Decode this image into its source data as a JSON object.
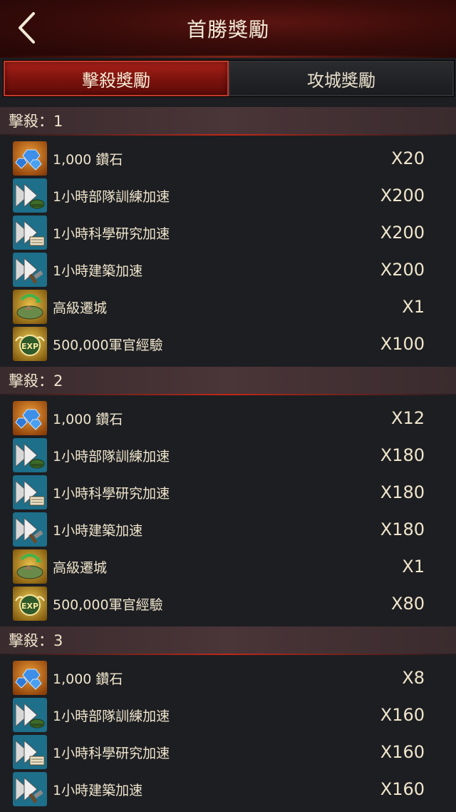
{
  "header": {
    "title": "首勝獎勵"
  },
  "tabs": [
    {
      "label": "擊殺獎勵",
      "active": true
    },
    {
      "label": "攻城獎勵",
      "active": false
    }
  ],
  "colors": {
    "accent": "#a82119",
    "icon_orange": "#c96a12",
    "icon_teal": "#1e6c86",
    "icon_gold": "#a87a18"
  },
  "sections": [
    {
      "label": "擊殺：1",
      "items": [
        {
          "icon": "diamond-icon",
          "name": "1,000 鑽石",
          "qty": "X20"
        },
        {
          "icon": "troop-speedup-icon",
          "name": "1小時部隊訓練加速",
          "qty": "X200"
        },
        {
          "icon": "research-speedup-icon",
          "name": "1小時科學研究加速",
          "qty": "X200"
        },
        {
          "icon": "build-speedup-icon",
          "name": "1小時建築加速",
          "qty": "X200"
        },
        {
          "icon": "relocate-icon",
          "name": "高級遷城",
          "qty": "X1"
        },
        {
          "icon": "exp-icon",
          "name": "500,000軍官經驗",
          "qty": "X100"
        }
      ]
    },
    {
      "label": "擊殺：2",
      "items": [
        {
          "icon": "diamond-icon",
          "name": "1,000 鑽石",
          "qty": "X12"
        },
        {
          "icon": "troop-speedup-icon",
          "name": "1小時部隊訓練加速",
          "qty": "X180"
        },
        {
          "icon": "research-speedup-icon",
          "name": "1小時科學研究加速",
          "qty": "X180"
        },
        {
          "icon": "build-speedup-icon",
          "name": "1小時建築加速",
          "qty": "X180"
        },
        {
          "icon": "relocate-icon",
          "name": "高級遷城",
          "qty": "X1"
        },
        {
          "icon": "exp-icon",
          "name": "500,000軍官經驗",
          "qty": "X80"
        }
      ]
    },
    {
      "label": "擊殺：3",
      "items": [
        {
          "icon": "diamond-icon",
          "name": "1,000 鑽石",
          "qty": "X8"
        },
        {
          "icon": "troop-speedup-icon",
          "name": "1小時部隊訓練加速",
          "qty": "X160"
        },
        {
          "icon": "research-speedup-icon",
          "name": "1小時科學研究加速",
          "qty": "X160"
        },
        {
          "icon": "build-speedup-icon",
          "name": "1小時建築加速",
          "qty": "X160"
        }
      ]
    }
  ]
}
